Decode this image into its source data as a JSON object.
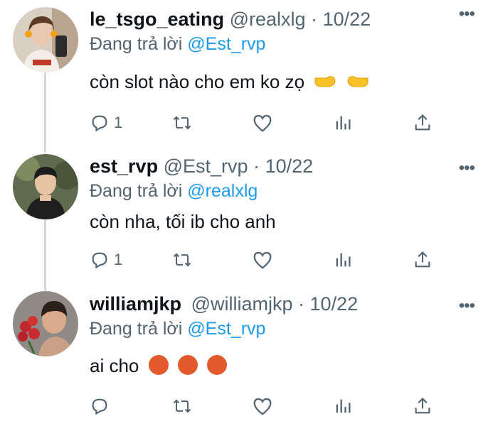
{
  "replies": [
    {
      "name": "le_tsgo_eating",
      "handle": "@realxlg",
      "separator": "·",
      "date": "10/22",
      "replying_prefix": "Đang trả lời",
      "replying_to": "@Est_rvp",
      "text": "còn slot nào cho em ko zọ",
      "text_emojis": [
        "backhand-index-pointing-right",
        "backhand-index-pointing-left"
      ],
      "reply_count": "1",
      "more_label": "•••"
    },
    {
      "name": "est_rvp",
      "handle": "@Est_rvp",
      "separator": "·",
      "date": "10/22",
      "replying_prefix": "Đang trả lời",
      "replying_to": "@realxlg",
      "text": "còn nha, tối ib cho anh",
      "text_emojis": [],
      "reply_count": "1",
      "more_label": "•••"
    },
    {
      "name": "williamjkp",
      "handle": "@williamjkp",
      "separator": "·",
      "date": "10/22",
      "replying_prefix": "Đang trả lời",
      "replying_to": "@Est_rvp",
      "text": "ai cho",
      "text_emojis": [
        "face-with-symbols-on-mouth",
        "face-with-symbols-on-mouth",
        "face-with-symbols-on-mouth"
      ],
      "reply_count": "",
      "more_label": "•••"
    }
  ],
  "icons": {
    "reply": "reply-icon",
    "retweet": "retweet-icon",
    "like": "heart-icon",
    "analytics": "analytics-icon",
    "share": "share-icon",
    "more": "more-icon"
  },
  "colors": {
    "text": "#0f1419",
    "secondary": "#536471",
    "link": "#1d9bf0",
    "thread_line": "#cfd9de"
  }
}
